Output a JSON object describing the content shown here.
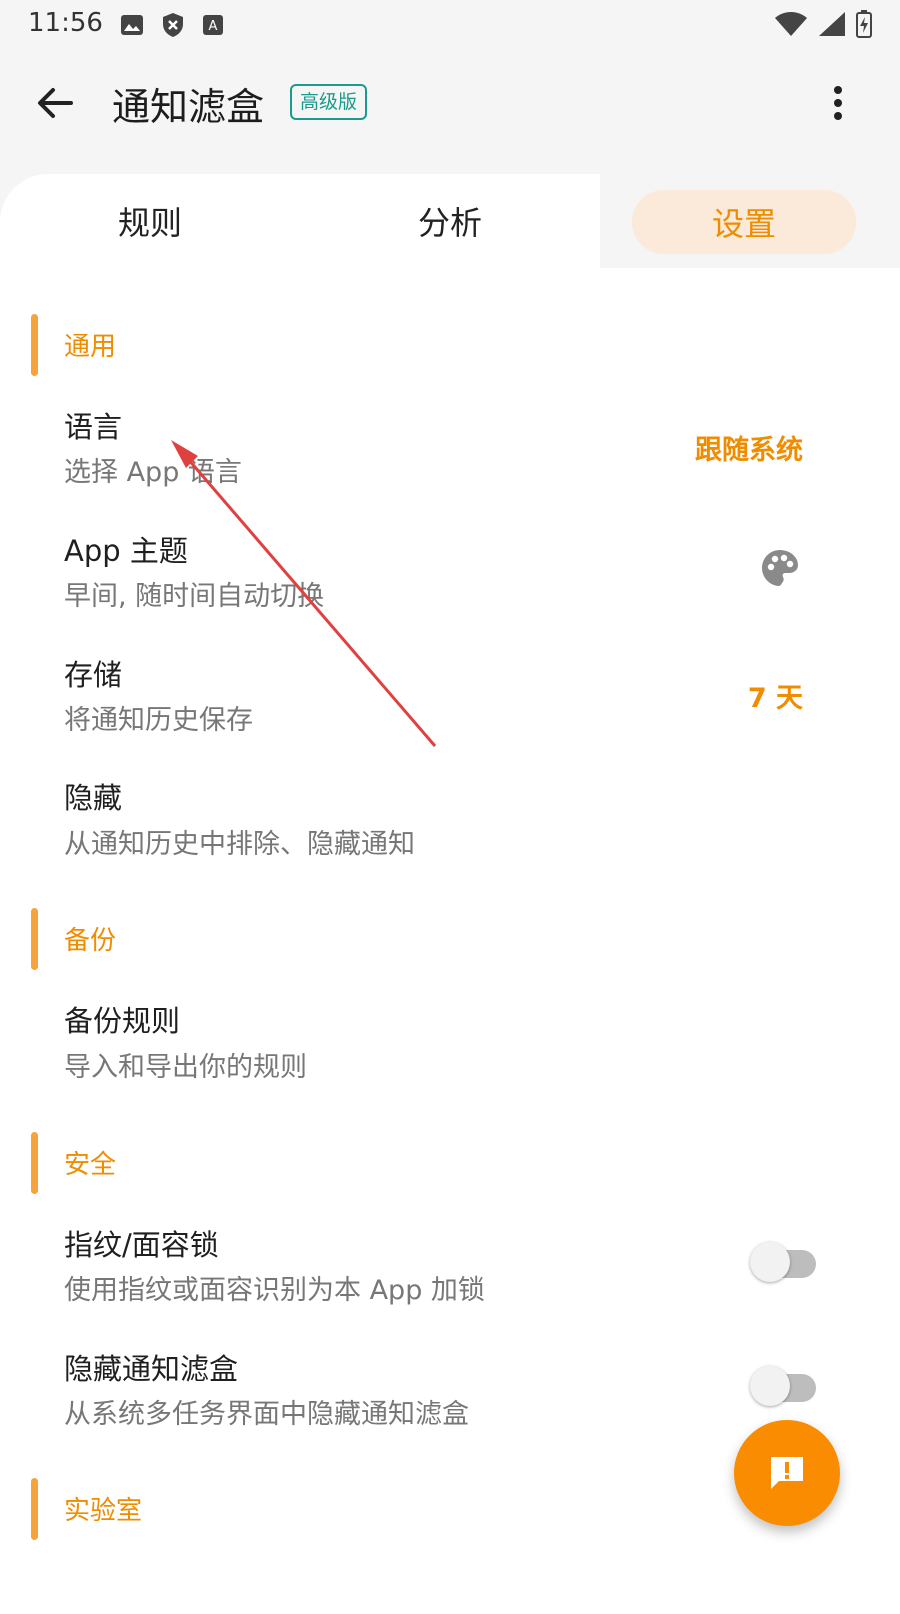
{
  "status_bar": {
    "time": "11:56"
  },
  "toolbar": {
    "title": "通知滤盒",
    "badge": "高级版"
  },
  "tabs": {
    "rules": "规则",
    "analysis": "分析",
    "settings": "设置"
  },
  "sections": {
    "general": "通用",
    "backup": "备份",
    "security": "安全",
    "lab": "实验室"
  },
  "items": {
    "language": {
      "title": "语言",
      "subtitle": "选择 App 语言",
      "value": "跟随系统"
    },
    "theme": {
      "title": "App 主题",
      "subtitle": "早间, 随时间自动切换"
    },
    "storage": {
      "title": "存储",
      "subtitle": "将通知历史保存",
      "value": "7 天"
    },
    "hide": {
      "title": "隐藏",
      "subtitle": "从通知历史中排除、隐藏通知"
    },
    "backup_rules": {
      "title": "备份规则",
      "subtitle": "导入和导出你的规则"
    },
    "biometric_lock": {
      "title": "指纹/面容锁",
      "subtitle": "使用指纹或面容识别为本 App 加锁",
      "enabled": false
    },
    "hide_app": {
      "title": "隐藏通知滤盒",
      "subtitle": "从系统多任务界面中隐藏通知滤盒",
      "enabled": false
    }
  },
  "colors": {
    "accent": "#f08c00",
    "badge": "#1a9b8c",
    "annotation_arrow": "#e04040"
  }
}
